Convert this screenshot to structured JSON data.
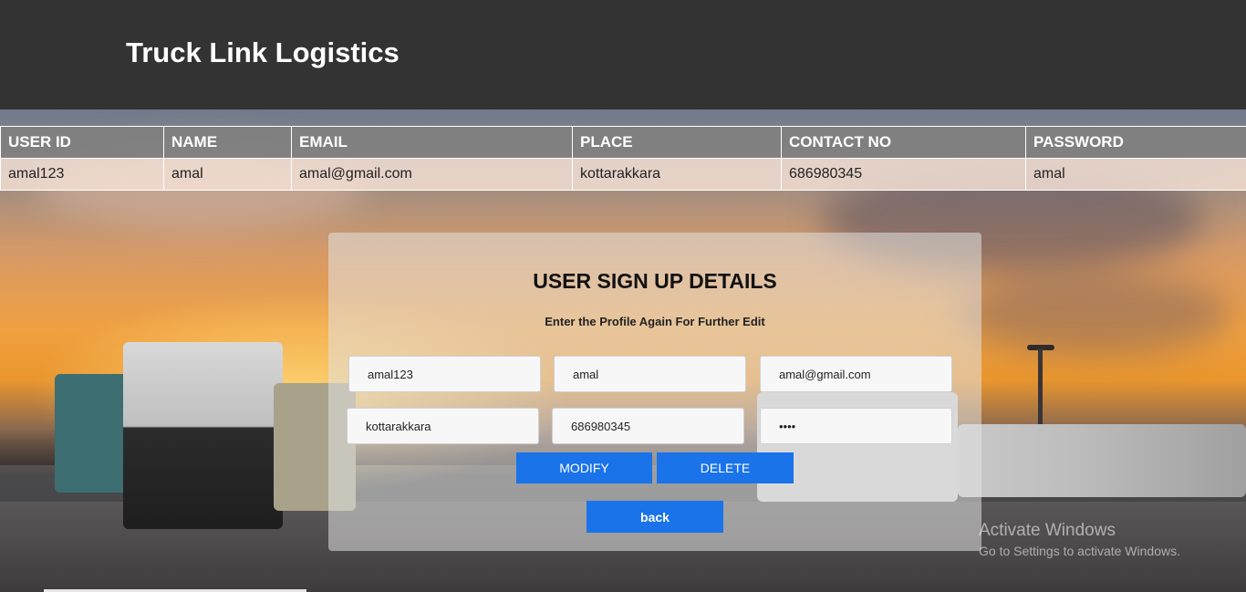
{
  "header": {
    "title": "Truck Link Logistics"
  },
  "table": {
    "columns": [
      "USER ID",
      "NAME",
      "EMAIL",
      "PLACE",
      "CONTACT NO",
      "PASSWORD"
    ],
    "row": [
      "amal123",
      "amal",
      "amal@gmail.com",
      "kottarakkara",
      "686980345",
      "amal"
    ]
  },
  "form": {
    "heading": "USER SIGN UP DETAILS",
    "subheading": "Enter the Profile Again For Further Edit",
    "user_id": "amal123",
    "name": "amal",
    "email": "amal@gmail.com",
    "place": "kottarakkara",
    "contact": "686980345",
    "password": "amal",
    "modify_label": "MODIFY",
    "delete_label": "DELETE",
    "back_label": "back"
  },
  "watermark": {
    "line1": "Activate Windows",
    "line2": "Go to Settings to activate Windows."
  },
  "colors": {
    "header_bg": "#333333",
    "button_blue": "#1a73e8",
    "table_header_bg": "#808080"
  }
}
